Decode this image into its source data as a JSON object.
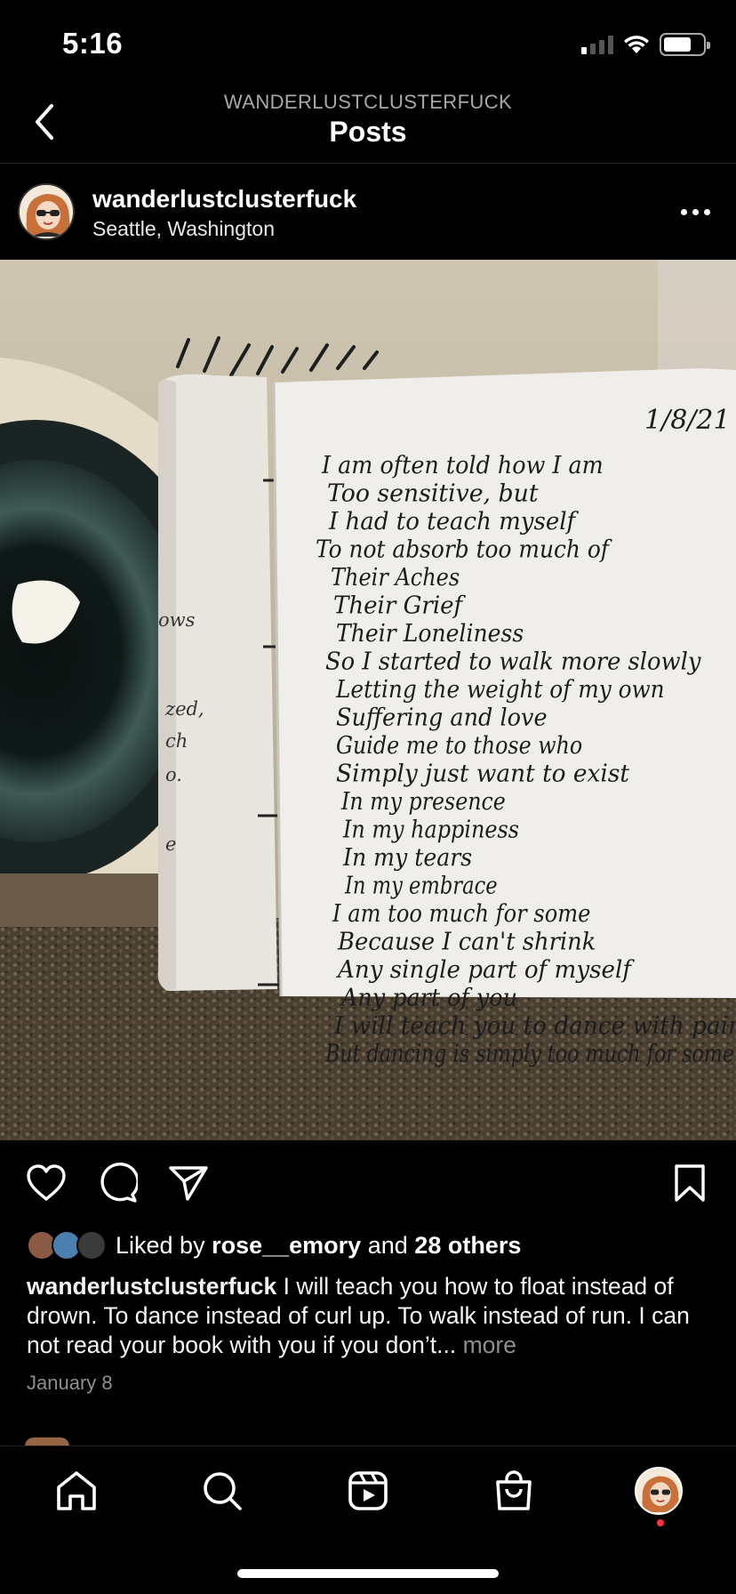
{
  "status_bar": {
    "time": "5:16",
    "signal_bars_active": 1,
    "signal_bars_total": 4,
    "battery_level": 0.72,
    "icons": [
      "cellular-signal-icon",
      "wifi-icon",
      "battery-icon"
    ]
  },
  "header": {
    "account_label": "WANDERLUSTCLUSTERFUCK",
    "title": "Posts",
    "back_icon": "chevron-left-icon"
  },
  "post": {
    "username": "wanderlustclusterfuck",
    "location": "Seattle, Washington",
    "more_icon": "ellipsis-icon",
    "image": {
      "date": "1/8/21",
      "poem_lines": [
        "I am often told how I am",
        "Too sensitive, but",
        "I had to teach myself",
        "To not absorb too much of",
        "Their Aches",
        "Their Grief",
        "Their Loneliness",
        "So I started to walk more slowly",
        "Letting the weight of my own",
        "Suffering and love",
        "Guide me to those who",
        "Simply just want to exist",
        "In my presence",
        "In my happiness",
        "In my tears",
        "In my embrace",
        "I am too much for some",
        "Because I can't shrink",
        "Any single part of myself",
        "Any part of you",
        "I will teach you to dance with pain",
        "But dancing is simply too much for some"
      ],
      "left_page_fragments": [
        "ows",
        "zed,",
        "ch",
        "o.",
        "e"
      ]
    },
    "actions": {
      "like_icon": "heart-icon",
      "comment_icon": "comment-bubble-icon",
      "share_icon": "paper-plane-icon",
      "save_icon": "bookmark-icon"
    },
    "likes": {
      "prefix": "Liked by",
      "first_user": "rose__emory",
      "conjunction": "and",
      "others": "28 others"
    },
    "caption": {
      "username": "wanderlustclusterfuck",
      "text": "I will teach you how to float instead of drown. To dance instead of curl up. To walk instead of run. I can not read your book with you if you don’t...",
      "more_label": "more"
    },
    "date": "January 8"
  },
  "tab_bar": {
    "items": [
      {
        "name": "home",
        "icon": "home-icon"
      },
      {
        "name": "search",
        "icon": "search-icon"
      },
      {
        "name": "reels",
        "icon": "reels-icon"
      },
      {
        "name": "shop",
        "icon": "shopping-bag-icon"
      },
      {
        "name": "profile",
        "icon": "profile-avatar"
      }
    ],
    "has_notification_dot": true
  },
  "colors": {
    "background": "#000000",
    "secondary_text": "#8e8e8e",
    "divider": "#262626",
    "notification": "#ff3040"
  }
}
